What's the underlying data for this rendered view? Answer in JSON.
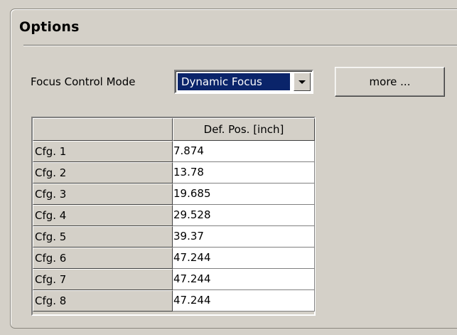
{
  "options": {
    "title": "Options",
    "focus_mode_label": "Focus Control Mode",
    "focus_mode_value": "Dynamic Focus",
    "more_button_label": "more ..."
  },
  "table": {
    "column_header": "Def. Pos. [inch]",
    "rows": [
      {
        "label": "Cfg. 1",
        "value": "7.874"
      },
      {
        "label": "Cfg. 2",
        "value": "13.78"
      },
      {
        "label": "Cfg. 3",
        "value": "19.685"
      },
      {
        "label": "Cfg. 4",
        "value": "29.528"
      },
      {
        "label": "Cfg. 5",
        "value": "39.37"
      },
      {
        "label": "Cfg. 6",
        "value": "47.244"
      },
      {
        "label": "Cfg. 7",
        "value": "47.244"
      },
      {
        "label": "Cfg. 8",
        "value": "47.244"
      }
    ]
  },
  "colors": {
    "window_bg": "#d4d0c8",
    "selection_bg": "#0a246a",
    "selection_text": "#ffffff",
    "cell_bg": "#ffffff"
  },
  "icons": {
    "combo_arrow": "chevron-down-icon"
  }
}
